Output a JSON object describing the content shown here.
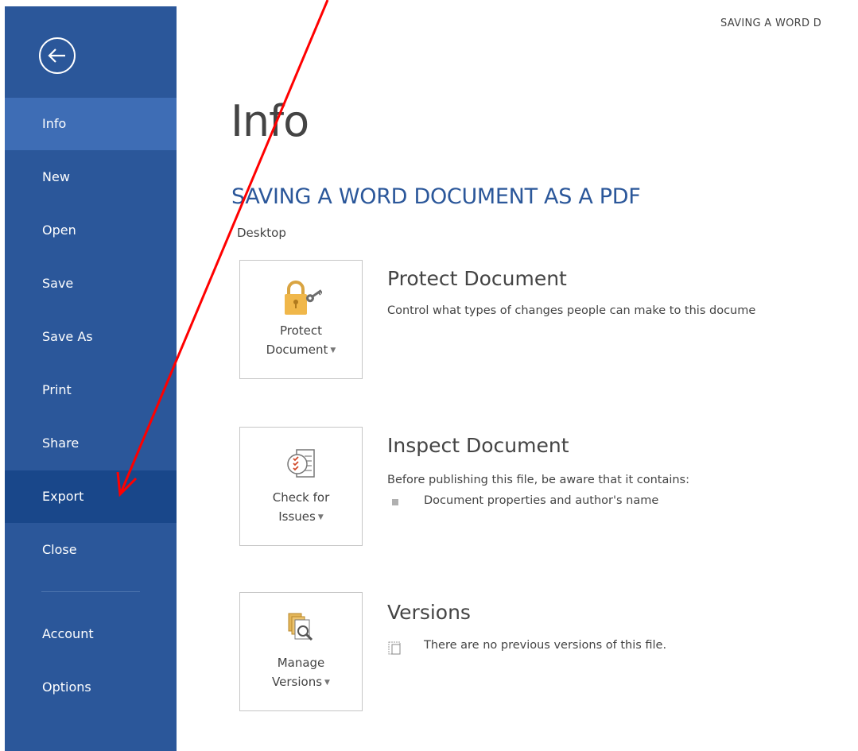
{
  "window_title": "SAVING A WORD D",
  "sidebar": {
    "items": [
      {
        "label": "Info"
      },
      {
        "label": "New"
      },
      {
        "label": "Open"
      },
      {
        "label": "Save"
      },
      {
        "label": "Save As"
      },
      {
        "label": "Print"
      },
      {
        "label": "Share"
      },
      {
        "label": "Export"
      },
      {
        "label": "Close"
      },
      {
        "label": "Account"
      },
      {
        "label": "Options"
      }
    ],
    "active": "Info",
    "highlighted": "Export"
  },
  "main": {
    "page_title": "Info",
    "document_title": "SAVING A WORD DOCUMENT AS A PDF",
    "location": "Desktop",
    "sections": [
      {
        "tile_line1": "Protect",
        "tile_line2": "Document",
        "heading": "Protect Document",
        "description": "Control what types of changes people can make to this docume",
        "icon": "lock-key-icon"
      },
      {
        "tile_line1": "Check for",
        "tile_line2": "Issues",
        "heading": "Inspect Document",
        "description": "Before publishing this file, be aware that it contains:",
        "bullets": [
          "Document properties and author's name"
        ],
        "icon": "checklist-icon"
      },
      {
        "tile_line1": "Manage",
        "tile_line2": "Versions",
        "heading": "Versions",
        "description": "There are no previous versions of this file.",
        "icon": "versions-magnifier-icon"
      }
    ]
  },
  "colors": {
    "sidebar": "#2b579a",
    "sidebar_active": "#3e6db5",
    "sidebar_hover": "#19478a",
    "accent_title": "#2b579a",
    "annotation_arrow": "#ff0000"
  }
}
